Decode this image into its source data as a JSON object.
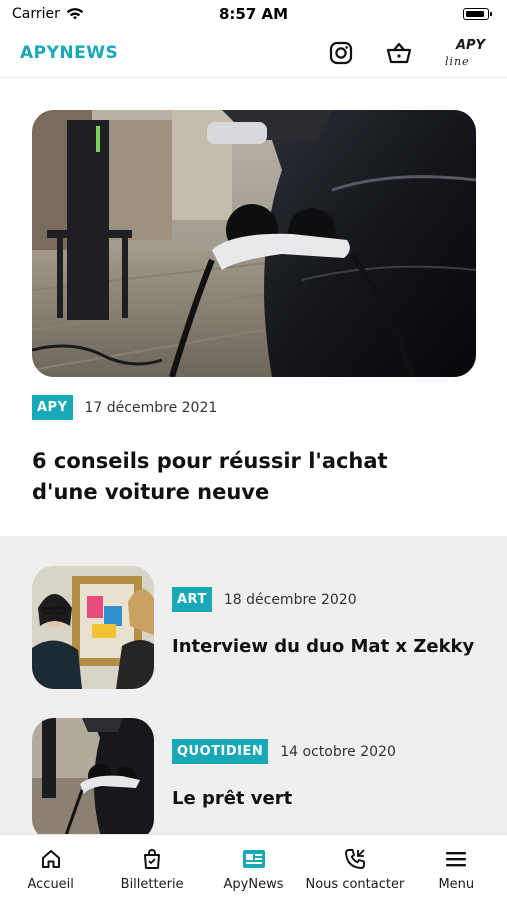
{
  "status_bar": {
    "carrier": "Carrier",
    "time": "8:57 AM"
  },
  "header": {
    "brand": "APYNEWS",
    "partner_logo_top": "APY",
    "partner_logo_bottom": "line"
  },
  "featured": {
    "tag": "APY",
    "date": "17 décembre 2021",
    "title": "6 conseils pour réussir l'achat d'une voiture neuve"
  },
  "articles": [
    {
      "tag": "ART",
      "date": "18 décembre 2020",
      "title": "Interview du duo Mat x Zekky"
    },
    {
      "tag": "QUOTIDIEN",
      "date": "14 octobre 2020",
      "title": "Le prêt vert"
    }
  ],
  "tabs": [
    {
      "label": "Accueil",
      "icon": "home-icon"
    },
    {
      "label": "Billetterie",
      "icon": "ticket-bag-icon"
    },
    {
      "label": "ApyNews",
      "icon": "news-icon"
    },
    {
      "label": "Nous contacter",
      "icon": "phone-icon"
    },
    {
      "label": "Menu",
      "icon": "hamburger-icon"
    }
  ],
  "colors": {
    "accent": "#17a9b8",
    "list_bg": "#efefef"
  }
}
